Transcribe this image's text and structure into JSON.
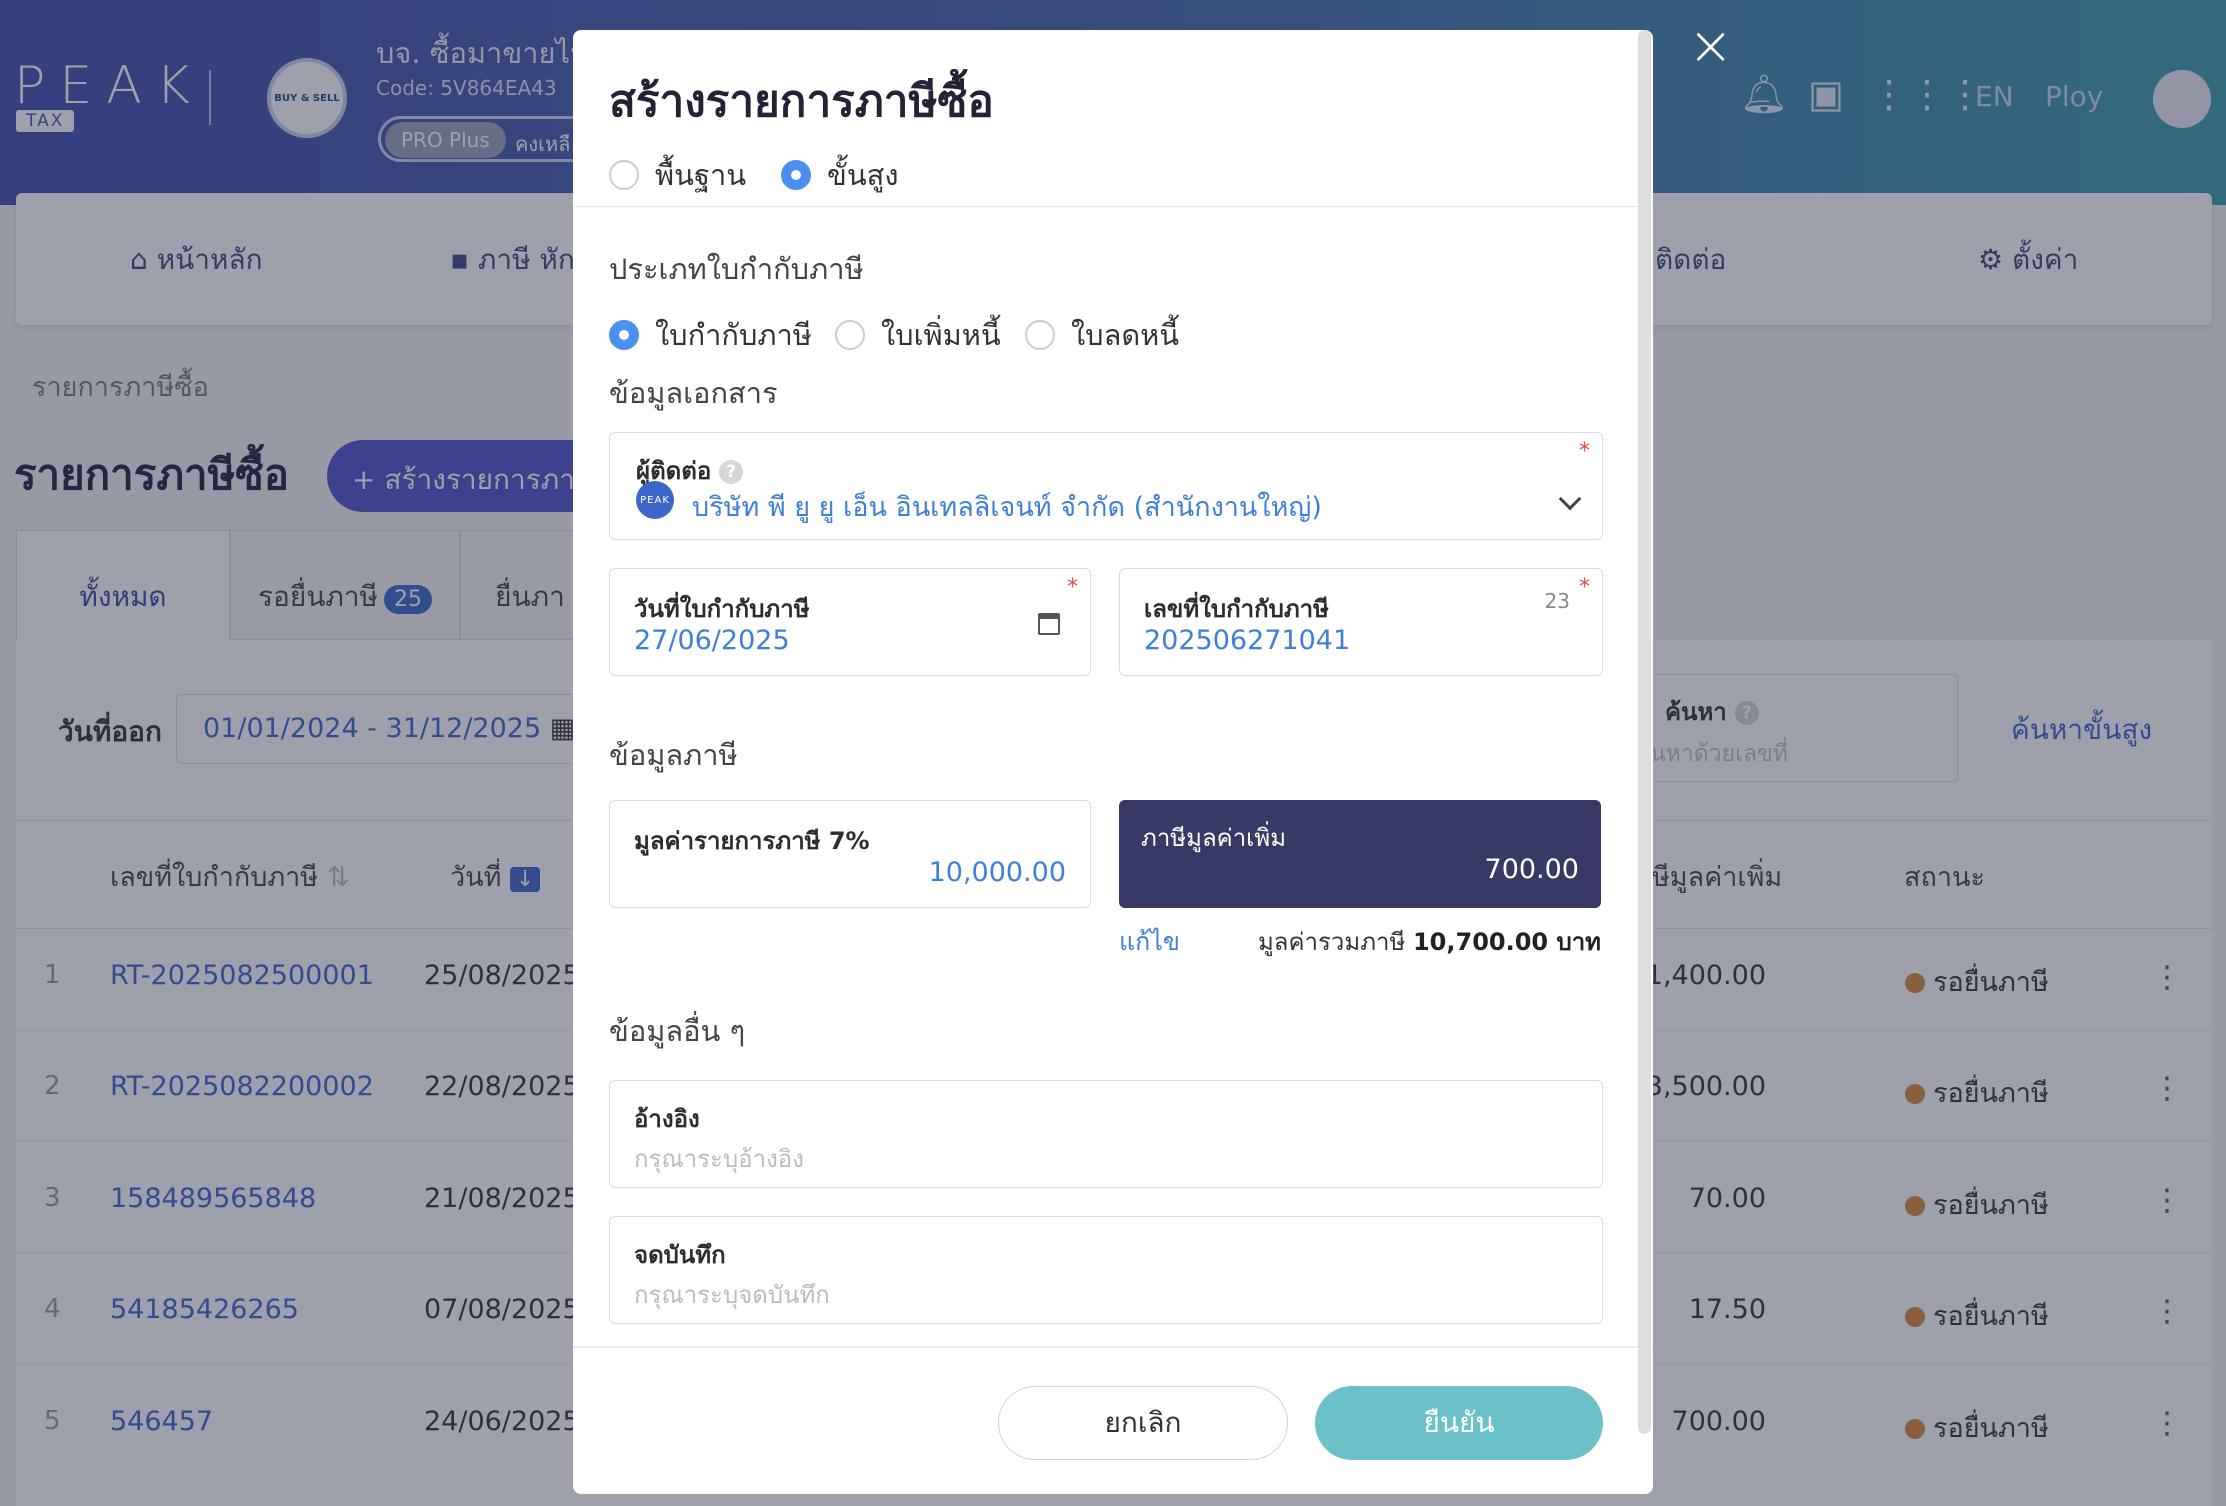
{
  "app": {
    "logo": "PEAK",
    "logo_sub": "TAX",
    "company_name": "บจ. ซื้อมาขายไป (",
    "company_code": "Code: 5V864EA43",
    "company_logo_text": "BUY & SELL",
    "plan": "PRO Plus",
    "plan_rest": "คงเหลื",
    "lang": "EN",
    "user": "Ploy"
  },
  "nav": {
    "home": "หน้าหลัก",
    "tax": "ภาษี หัก",
    "contacts": "ติดต่อ",
    "settings": "ตั้งค่า"
  },
  "page": {
    "breadcrumb": "รายการภาษีซื้อ",
    "title": "รายการภาษีซื้อ",
    "create_button": "+ สร้างรายการภา"
  },
  "tabs": [
    {
      "label": "ทั้งหมด"
    },
    {
      "label": "รอยื่นภาษี",
      "badge": "25"
    },
    {
      "label": "ยื่นภา"
    }
  ],
  "filters": {
    "date_label": "วันที่ออก",
    "date_range": "01/01/2024 - 31/12/2025",
    "search_label": "ค้นหา",
    "search_placeholder": "นหาด้วยเลขที่",
    "advanced_search": "ค้นหาขั้นสูง"
  },
  "table": {
    "headers": {
      "doc_no": "เลขที่ใบกำกับภาษี",
      "date": "วันที่",
      "vat": "ษีมูลค่าเพิ่ม",
      "status": "สถานะ"
    },
    "rows": [
      {
        "num": "1",
        "doc": "RT-2025082500001",
        "date": "25/08/2025",
        "vat": "1,400.00",
        "status": "รอยื่นภาษี"
      },
      {
        "num": "2",
        "doc": "RT-2025082200002",
        "date": "22/08/2025",
        "vat": "3,500.00",
        "status": "รอยื่นภาษี"
      },
      {
        "num": "3",
        "doc": "158489565848",
        "date": "21/08/2025",
        "vat": "70.00",
        "status": "รอยื่นภาษี"
      },
      {
        "num": "4",
        "doc": "54185426265",
        "date": "07/08/2025",
        "vat": "17.50",
        "status": "รอยื่นภาษี"
      },
      {
        "num": "5",
        "doc": "546457",
        "date": "24/06/2025",
        "vat": "700.00",
        "status": "รอยื่นภาษี"
      }
    ]
  },
  "modal": {
    "title": "สร้างรายการภาษีซื้อ",
    "mode_options": [
      {
        "label": "พื้นฐาน",
        "selected": false
      },
      {
        "label": "ขั้นสูง",
        "selected": true
      }
    ],
    "invoice_type_label": "ประเภทใบกำกับภาษี",
    "invoice_types": [
      {
        "label": "ใบกำกับภาษี",
        "selected": true
      },
      {
        "label": "ใบเพิ่มหนี้",
        "selected": false
      },
      {
        "label": "ใบลดหนี้",
        "selected": false
      }
    ],
    "doc_info_label": "ข้อมูลเอกสาร",
    "contact": {
      "label": "ผู้ติดต่อ",
      "value": "บริษัท พี ยู ยู เอ็น อินเทลลิเจนท์ จำกัด (สำนักงานใหญ่)",
      "logo_text": "PEAK"
    },
    "invoice_date": {
      "label": "วันที่ใบกำกับภาษี",
      "value": "27/06/2025"
    },
    "invoice_no": {
      "label": "เลขที่ใบกำกับภาษี",
      "value": "202506271041",
      "counter": "23"
    },
    "tax_info_label": "ข้อมูลภาษี",
    "taxable_amount": {
      "label": "มูลค่ารายการภาษี 7%",
      "value": "10,000.00"
    },
    "vat": {
      "label": "ภาษีมูลค่าเพิ่ม",
      "value": "700.00"
    },
    "edit_link": "แก้ไข",
    "total_prefix": "มูลค่ารวมภาษี",
    "total_value": "10,700.00 บาท",
    "other_info_label": "ข้อมูลอื่น ๆ",
    "reference": {
      "label": "อ้างอิง",
      "placeholder": "กรุณาระบุอ้างอิง"
    },
    "note": {
      "label": "จดบันทึก",
      "placeholder": "กรุณาระบุจดบันทึก"
    },
    "cancel_button": "ยกเลิก",
    "confirm_button": "ยืนยัน",
    "required_mark": "*",
    "help_mark": "?"
  },
  "colors": {
    "accent": "#4c8ff0",
    "vat_box": "#373a64",
    "confirm": "#6cc0c8",
    "status_dot": "#d98a38"
  }
}
